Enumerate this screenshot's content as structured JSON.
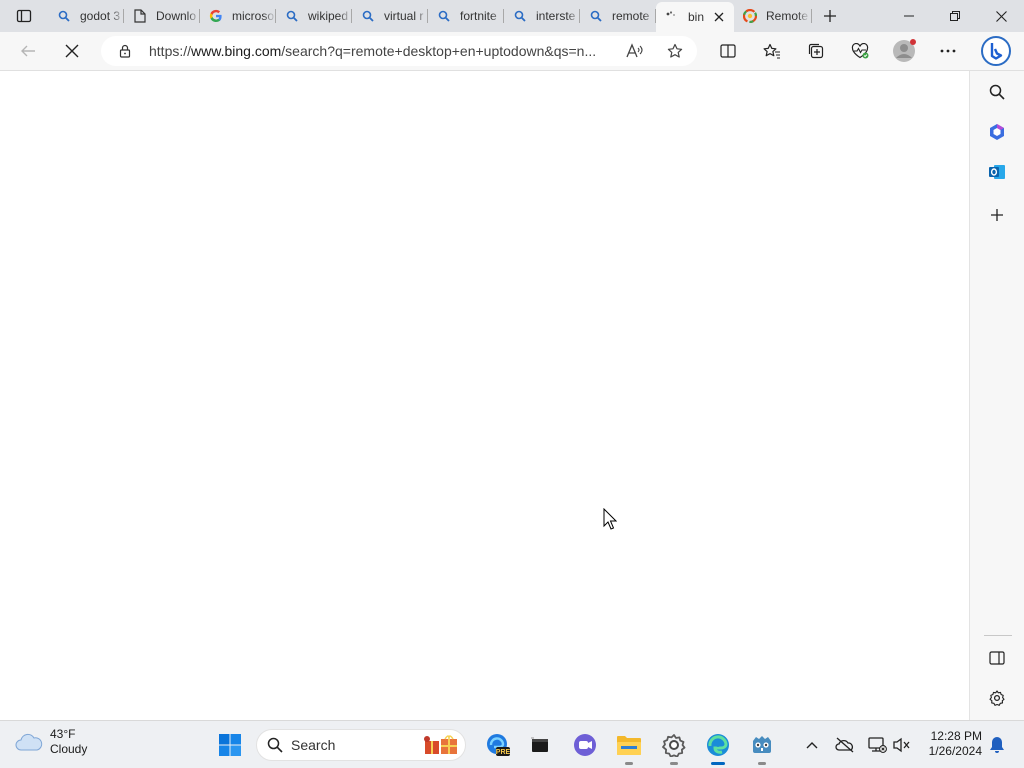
{
  "browser": {
    "tabs": [
      {
        "title": "godot 3",
        "favicon": "search-icon"
      },
      {
        "title": "Downlo",
        "favicon": "page-icon"
      },
      {
        "title": "microso",
        "favicon": "google-icon"
      },
      {
        "title": "wikiped",
        "favicon": "search-icon"
      },
      {
        "title": "virtual r",
        "favicon": "search-icon"
      },
      {
        "title": "fortnite",
        "favicon": "search-icon"
      },
      {
        "title": "interste",
        "favicon": "search-icon"
      },
      {
        "title": "remote",
        "favicon": "search-icon"
      },
      {
        "title": "bin",
        "favicon": "loading-icon",
        "active": true
      },
      {
        "title": "Remote",
        "favicon": "remote-app-icon"
      }
    ],
    "address": {
      "prefix": "https://",
      "host": "www.bing.com",
      "path": "/search?q=remote+desktop+en+uptodown&qs=n..."
    },
    "accent": "#0067c0"
  },
  "taskbar": {
    "weather": {
      "temp": "43°F",
      "condition": "Cloudy",
      "icon": "cloud-icon"
    },
    "search_label": "Search",
    "apps": [
      "start-icon",
      "gifts-icon",
      "edge-beta-icon",
      "terminal-icon",
      "teams-icon",
      "file-explorer-icon",
      "settings-icon",
      "edge-icon",
      "godot-icon"
    ],
    "clock": {
      "time": "12:28 PM",
      "date": "1/26/2024"
    }
  }
}
